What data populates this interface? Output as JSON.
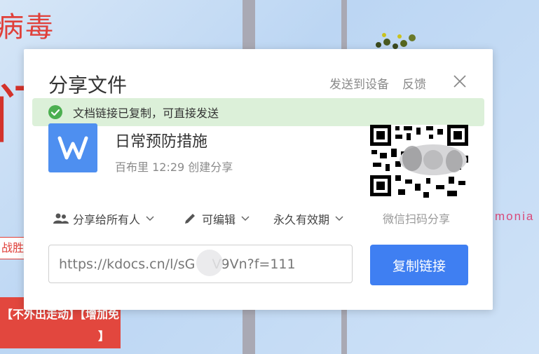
{
  "background": {
    "poster_title": "病毒",
    "poster_glyph": "门",
    "tag_text": "战胜肺炎",
    "red_box_line1": "【不外出走动】【增加免",
    "red_box_line2": "】",
    "side_text": "monia"
  },
  "dialog": {
    "title": "分享文件",
    "send_to_device": "发送到设备",
    "feedback": "反馈",
    "toast_text": "文档链接已复制，可直接发送",
    "file": {
      "icon_letter": "W",
      "name": "日常预防措施",
      "meta": "百布里 12:29 创建分享"
    },
    "qr_caption": "微信扫码分享",
    "options": {
      "share_scope": "分享给所有人",
      "permission": "可编辑",
      "validity": "永久有效期"
    },
    "url": "https://kdocs.cn/l/sG    V9Vn?f=111",
    "copy_button": "复制链接"
  },
  "colors": {
    "accent": "#3f7ff2",
    "toast_bg": "#dcf0d9",
    "success": "#4caf50",
    "file_icon_bg": "#4e8ff0"
  },
  "icons": [
    "close-icon",
    "check-circle-icon",
    "users-icon",
    "pencil-icon",
    "chevron-down-icon",
    "wps-writer-icon",
    "qr-code"
  ]
}
